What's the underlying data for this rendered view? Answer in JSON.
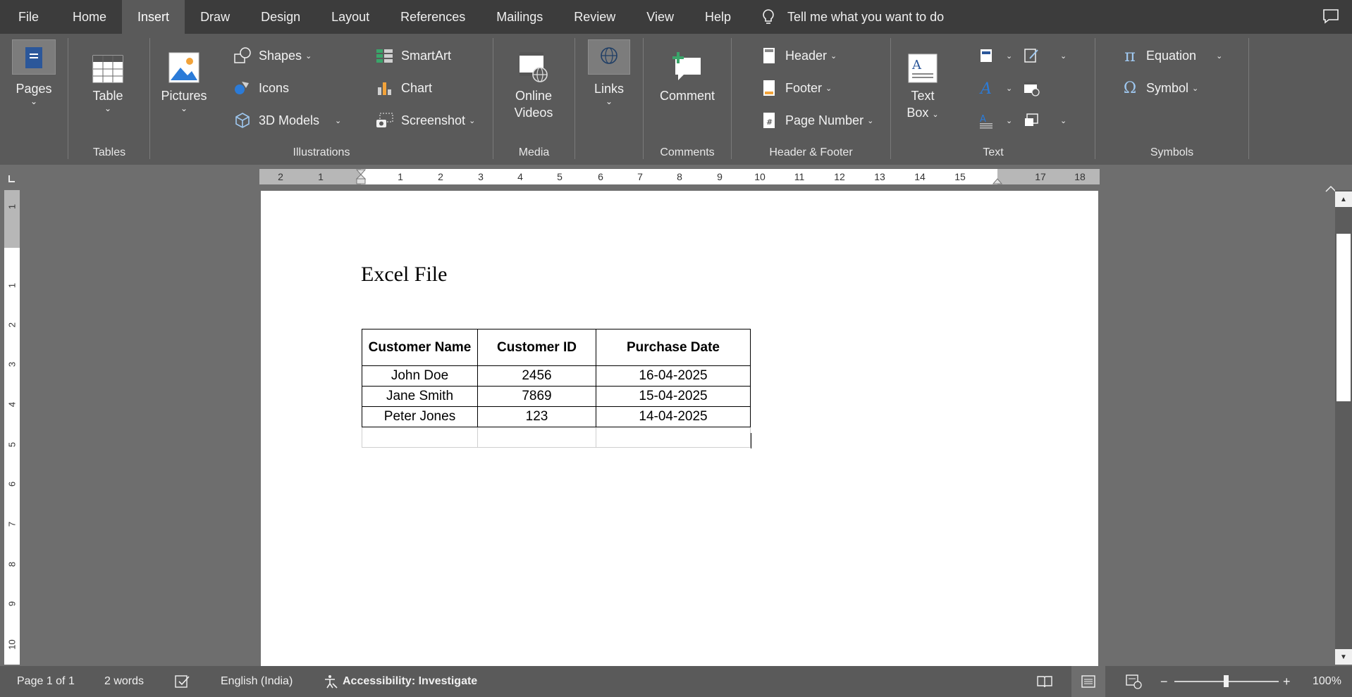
{
  "menu": {
    "tabs": [
      "File",
      "Home",
      "Insert",
      "Draw",
      "Design",
      "Layout",
      "References",
      "Mailings",
      "Review",
      "View",
      "Help"
    ],
    "active_tab": "Insert",
    "tell_me": "Tell me what you want to do"
  },
  "ribbon": {
    "pages": {
      "label": "Pages"
    },
    "tables": {
      "table_label": "Table",
      "group_label": "Tables"
    },
    "illustrations": {
      "pictures": "Pictures",
      "shapes": "Shapes",
      "icons": "Icons",
      "models": "3D Models",
      "smartart": "SmartArt",
      "chart": "Chart",
      "screenshot": "Screenshot",
      "group_label": "Illustrations"
    },
    "media": {
      "online_videos_line1": "Online",
      "online_videos_line2": "Videos",
      "group_label": "Media"
    },
    "links": {
      "label": "Links"
    },
    "comments": {
      "comment": "Comment",
      "group_label": "Comments"
    },
    "header_footer": {
      "header": "Header",
      "footer": "Footer",
      "page_number": "Page Number",
      "group_label": "Header & Footer"
    },
    "text": {
      "text_box_line1": "Text",
      "text_box_line2": "Box",
      "group_label": "Text"
    },
    "symbols": {
      "equation": "Equation",
      "symbol": "Symbol",
      "group_label": "Symbols"
    }
  },
  "ruler": {
    "h_numbers": [
      "2",
      "1",
      "1",
      "2",
      "3",
      "4",
      "5",
      "6",
      "7",
      "8",
      "9",
      "10",
      "11",
      "12",
      "13",
      "14",
      "15",
      "17",
      "18"
    ],
    "v_numbers": [
      "1",
      "1",
      "2",
      "3",
      "4",
      "5",
      "6",
      "7",
      "8",
      "9",
      "10"
    ]
  },
  "document": {
    "title": "Excel File",
    "table": {
      "headers": [
        "Customer Name",
        "Customer ID",
        "Purchase Date"
      ],
      "rows": [
        [
          "John Doe",
          "2456",
          "16-04-2025"
        ],
        [
          "Jane Smith",
          "7869",
          "15-04-2025"
        ],
        [
          "Peter Jones",
          "123",
          "14-04-2025"
        ]
      ]
    }
  },
  "status": {
    "page": "Page 1 of 1",
    "words": "2 words",
    "language": "English (India)",
    "accessibility": "Accessibility: Investigate",
    "zoom": "100%",
    "zoom_minus": "−",
    "zoom_plus": "+"
  },
  "colors": {
    "ribbon_bg": "#5a5a5a",
    "menubar_bg": "#3c3c3c",
    "active_tab_bg": "#5a5a5a",
    "workspace_bg": "#6e6e6e"
  }
}
